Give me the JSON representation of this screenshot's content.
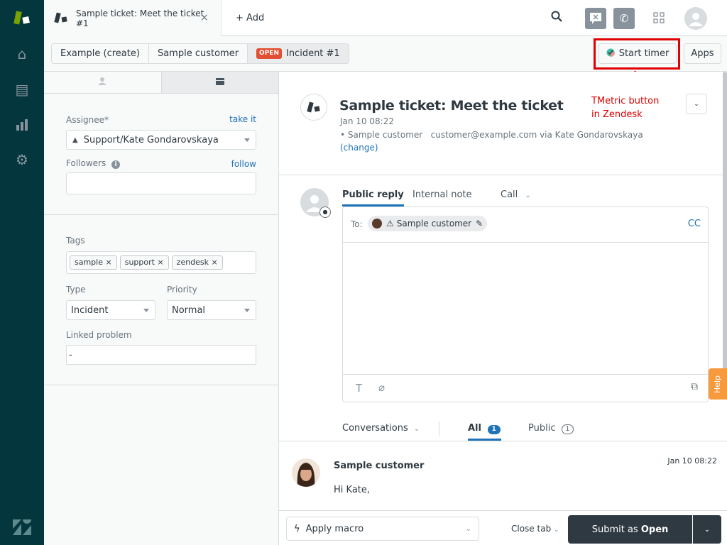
{
  "tab": {
    "title_line1": "Sample ticket: Meet the ticket",
    "title_line2": "#1",
    "close": "×"
  },
  "add_label": "Add",
  "breadcrumbs": [
    "Example (create)",
    "Sample customer"
  ],
  "status_badge": "OPEN",
  "incident_crumb": "Incident #1",
  "start_timer": "Start timer",
  "apps": "Apps",
  "annotation": {
    "line1": "TMetric button",
    "line2": "in Zendesk"
  },
  "props": {
    "assignee_label": "Assignee*",
    "take_it": "take it",
    "assignee_value": "Support/Kate Gondarovskaya",
    "followers_label": "Followers",
    "follow": "follow",
    "tags_label": "Tags",
    "tags": [
      "sample",
      "support",
      "zendesk"
    ],
    "type_label": "Type",
    "type_value": "Incident",
    "priority_label": "Priority",
    "priority_value": "Normal",
    "linked_label": "Linked problem",
    "linked_value": "-"
  },
  "ticket": {
    "title": "Sample ticket: Meet the ticket",
    "date": "Jan 10 08:22",
    "meta": "• Sample customer   customer@example.com via Kate Gondarovskaya",
    "change": "(change)"
  },
  "composer": {
    "tabs": [
      "Public reply",
      "Internal note",
      "Call"
    ],
    "to_label": "To:",
    "recipient": "Sample customer",
    "cc": "CC"
  },
  "help": "Help",
  "conversations": {
    "filter": "Conversations",
    "all": "All",
    "all_count": "1",
    "public": "Public",
    "public_count": "1"
  },
  "message": {
    "author": "Sample customer",
    "time": "Jan 10 08:22",
    "body": "Hi Kate,"
  },
  "footer": {
    "macro": "Apply macro",
    "close_tab": "Close tab",
    "submit_prefix": "Submit as ",
    "submit_status": "Open"
  }
}
